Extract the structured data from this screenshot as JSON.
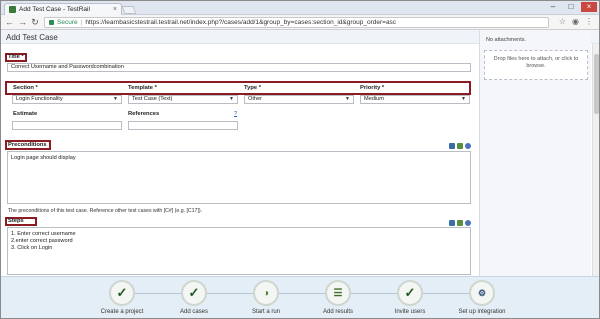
{
  "browser": {
    "tab_title": "Add Test Case - TestRail",
    "secure_label": "Secure",
    "url": "https://learnbasicstestrail.testrail.net/index.php?/cases/add/1&group_by=cases:section_id&group_order=asc"
  },
  "page": {
    "title": "Add Test Case"
  },
  "form": {
    "title_label": "Title *",
    "title_value": "Correct Username and Passwordcombination",
    "section_label": "Section *",
    "section_value": "Login Functionality",
    "template_label": "Template *",
    "template_value": "Test Case (Text)",
    "type_label": "Type *",
    "type_value": "Other",
    "priority_label": "Priority *",
    "priority_value": "Medium",
    "estimate_label": "Estimate",
    "references_label": "References",
    "references_help": "?",
    "preconditions_label": "Preconditions",
    "preconditions_value": "Login page should display",
    "preconditions_hint": "The preconditions of this test case. Reference other test cases with [C#] (e.g. [C17]).",
    "steps_label": "Steps",
    "steps_value": "1. Enter correct username\n2.enter correct password\n3. Click on Login"
  },
  "sidebar": {
    "attachments_text": "No attachments.",
    "drop_text": "Drop files here to attach, or click to browse."
  },
  "onboarding": {
    "steps": [
      {
        "label": "Create a project",
        "icon": "checkmark-icon"
      },
      {
        "label": "Add cases",
        "icon": "checkmark-icon"
      },
      {
        "label": "Start a run",
        "icon": "run-icon"
      },
      {
        "label": "Add results",
        "icon": "results-icon"
      },
      {
        "label": "Invite users",
        "icon": "checkmark-icon"
      },
      {
        "label": "Set up integration",
        "icon": "integration-icon"
      }
    ]
  },
  "colors": {
    "highlight_box": "#8b1c24",
    "accent_green": "#1d5a1d",
    "header_bg": "#f0f4f8",
    "bottom_bg": "#e4eef7"
  }
}
